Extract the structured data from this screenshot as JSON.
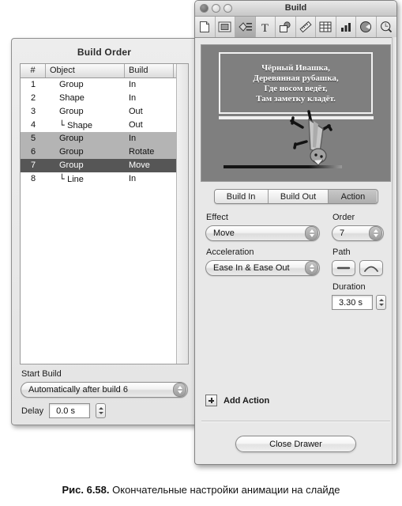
{
  "build_order_window": {
    "title": "Build Order",
    "table": {
      "headers": [
        "#",
        "Object",
        "Build"
      ],
      "rows": [
        {
          "num": "1",
          "object": "Group",
          "build": "In",
          "indent": false,
          "state": "normal"
        },
        {
          "num": "2",
          "object": "Shape",
          "build": "In",
          "indent": false,
          "state": "normal"
        },
        {
          "num": "3",
          "object": "Group",
          "build": "Out",
          "indent": false,
          "state": "normal"
        },
        {
          "num": "4",
          "object": "Shape",
          "build": "Out",
          "indent": true,
          "state": "normal"
        },
        {
          "num": "5",
          "object": "Group",
          "build": "In",
          "indent": false,
          "state": "selected-light"
        },
        {
          "num": "6",
          "object": "Group",
          "build": "Rotate",
          "indent": false,
          "state": "selected-light"
        },
        {
          "num": "7",
          "object": "Group",
          "build": "Move",
          "indent": false,
          "state": "selected-dark"
        },
        {
          "num": "8",
          "object": "Line",
          "build": "In",
          "indent": true,
          "state": "normal"
        }
      ]
    },
    "start_build_label": "Start Build",
    "start_build_value": "Automatically after build 6",
    "delay_label": "Delay",
    "delay_value": "0.0 s"
  },
  "build_window": {
    "title": "Build",
    "traffic_lights": [
      "close-button",
      "minimize-button",
      "zoom-button"
    ],
    "toolbar": [
      {
        "name": "new-document-icon",
        "active": false
      },
      {
        "name": "media-frame-icon",
        "active": false
      },
      {
        "name": "inspector-icon",
        "active": true
      },
      {
        "name": "text-icon",
        "active": false
      },
      {
        "name": "shapes-icon",
        "active": false
      },
      {
        "name": "measure-icon",
        "active": false
      },
      {
        "name": "table-icon",
        "active": false
      },
      {
        "name": "chart-icon",
        "active": false
      },
      {
        "name": "colors-icon",
        "active": false
      },
      {
        "name": "search-icon",
        "active": false
      }
    ],
    "slide": {
      "text_lines": [
        "Чёрный Ивашка,",
        "Деревянная рубашка,",
        "Где носом ведёт,",
        "Там заметку кладёт."
      ]
    },
    "tabs": [
      {
        "label": "Build In",
        "active": false
      },
      {
        "label": "Build Out",
        "active": false
      },
      {
        "label": "Action",
        "active": true
      }
    ],
    "inspector": {
      "effect_label": "Effect",
      "effect_value": "Move",
      "order_label": "Order",
      "order_value": "7",
      "acceleration_label": "Acceleration",
      "acceleration_value": "Ease In & Ease Out",
      "path_label": "Path",
      "path_options": [
        {
          "name": "path-straight-icon",
          "selected": false
        },
        {
          "name": "path-curved-icon",
          "selected": false
        }
      ],
      "duration_label": "Duration",
      "duration_value": "3.30 s"
    },
    "add_action_label": "Add Action",
    "close_drawer_label": "Close Drawer"
  },
  "caption": {
    "figure_number": "Рис. 6.58.",
    "text": "Окончательные настройки анимации на слайде"
  }
}
